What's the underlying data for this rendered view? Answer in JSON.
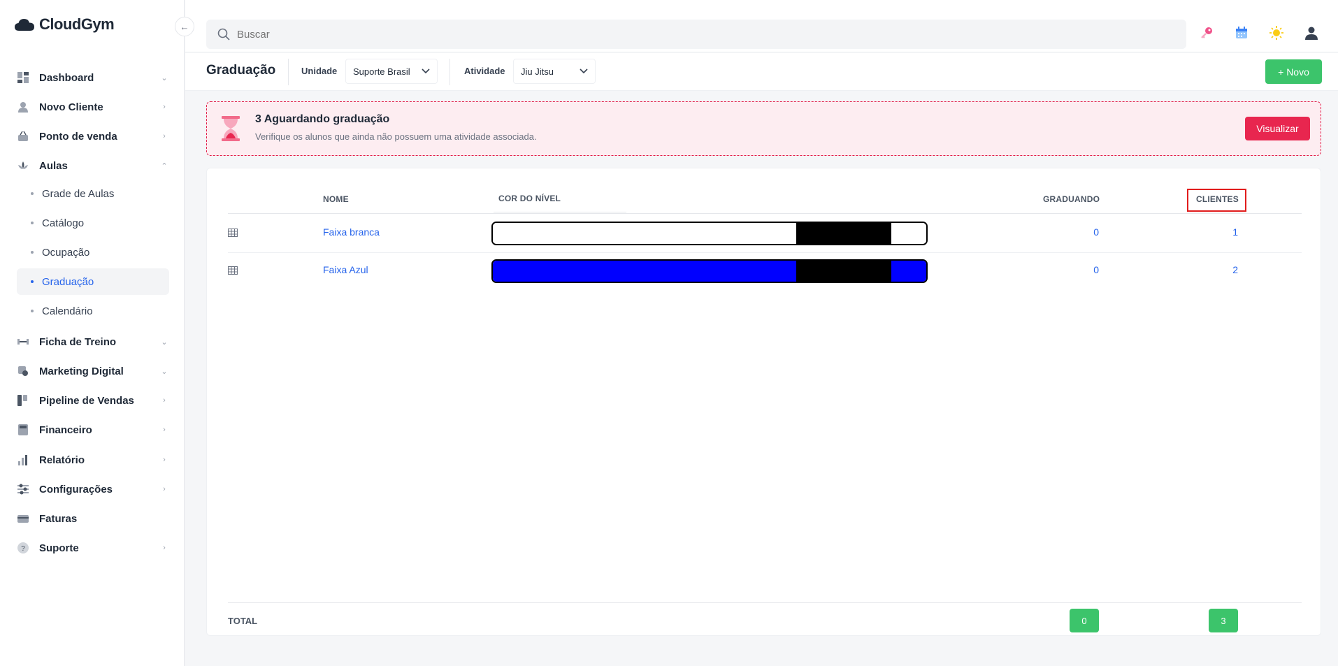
{
  "app": {
    "name": "CloudGym"
  },
  "search": {
    "placeholder": "Buscar"
  },
  "sidebar": {
    "items": [
      {
        "label": "Dashboard",
        "icon": "dashboard-icon",
        "chevron": "down"
      },
      {
        "label": "Novo Cliente",
        "icon": "user-icon",
        "chevron": "right"
      },
      {
        "label": "Ponto de venda",
        "icon": "basket-icon",
        "chevron": "right"
      },
      {
        "label": "Aulas",
        "icon": "lotus-icon",
        "chevron": "up"
      },
      {
        "label": "Ficha de Treino",
        "icon": "dumbbell-icon",
        "chevron": "down"
      },
      {
        "label": "Marketing Digital",
        "icon": "marketing-icon",
        "chevron": "down"
      },
      {
        "label": "Pipeline de Vendas",
        "icon": "pipeline-icon",
        "chevron": "right"
      },
      {
        "label": "Financeiro",
        "icon": "calculator-icon",
        "chevron": "right"
      },
      {
        "label": "Relatório",
        "icon": "bar-chart-icon",
        "chevron": "right"
      },
      {
        "label": "Configurações",
        "icon": "sliders-icon",
        "chevron": "right"
      },
      {
        "label": "Faturas",
        "icon": "credit-card-icon",
        "chevron": ""
      },
      {
        "label": "Suporte",
        "icon": "help-icon",
        "chevron": "right"
      }
    ],
    "aulas_sub": [
      {
        "label": "Grade de Aulas"
      },
      {
        "label": "Catálogo"
      },
      {
        "label": "Ocupação"
      },
      {
        "label": "Graduação",
        "active": true
      },
      {
        "label": "Calendário"
      }
    ]
  },
  "subheader": {
    "title": "Graduação",
    "unidade_label": "Unidade",
    "unidade_value": "Suporte Brasil",
    "atividade_label": "Atividade",
    "atividade_value": "Jiu Jitsu",
    "novo_label": "+ Novo"
  },
  "alert": {
    "title": "3 Aguardando graduação",
    "subtitle": "Verifique os alunos que ainda não possuem uma atividade associada.",
    "button": "Visualizar"
  },
  "table": {
    "headers": {
      "nome": "NOME",
      "cor": "COR DO NÍVEL",
      "graduando": "GRADUANDO",
      "clientes": "CLIENTES"
    },
    "rows": [
      {
        "nome": "Faixa branca",
        "graduando": "0",
        "clientes": "1",
        "belt_color": "#ffffff",
        "tip_color": "#000000"
      },
      {
        "nome": "Faixa Azul",
        "graduando": "0",
        "clientes": "2",
        "belt_color": "#0000ff",
        "tip_color": "#000000"
      }
    ],
    "total_label": "TOTAL",
    "total_graduando": "0",
    "total_clientes": "3"
  },
  "colors": {
    "accent": "#2563eb",
    "success": "#3cc46b",
    "danger": "#e8264f"
  }
}
